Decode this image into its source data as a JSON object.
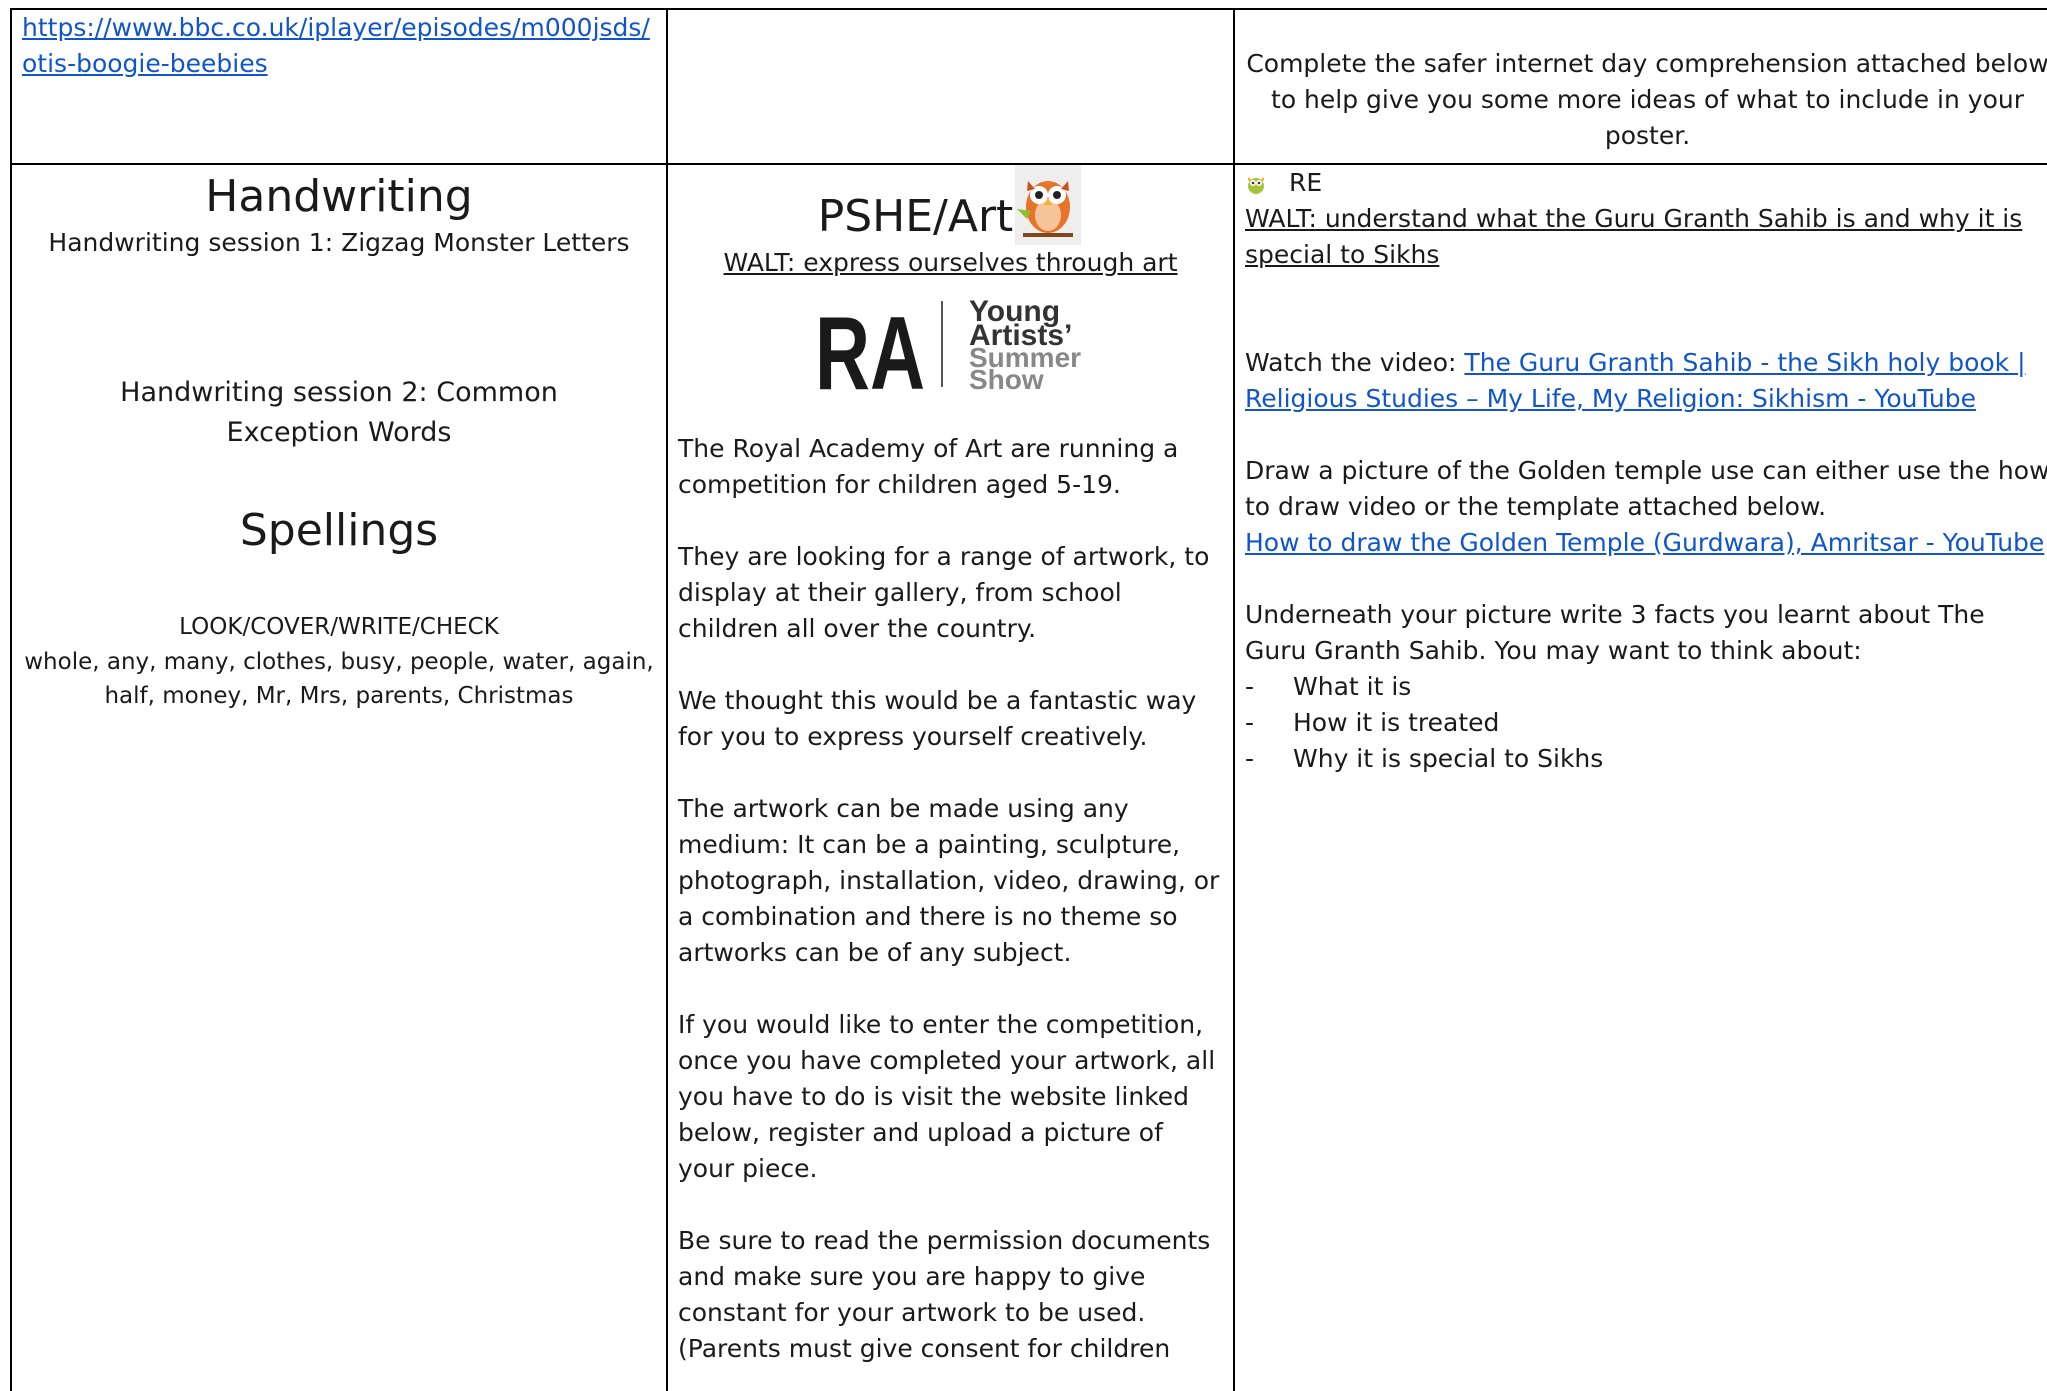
{
  "top_row": {
    "link_text_line1": "https://www.bbc.co.uk/iplayer/episodes/m000jsds/",
    "link_text_line2": "otis-boogie-beebies",
    "comprehension_text": "Complete the safer internet day comprehension attached below to help give you some more ideas of what to include in your poster."
  },
  "handwriting": {
    "heading": "Handwriting",
    "session1": "Handwriting session 1: Zigzag Monster Letters",
    "session2": "Handwriting session 2: Common Exception Words",
    "spellings_heading": "Spellings",
    "method": "LOOK/COVER/WRITE/CHECK",
    "words": "whole, any, many, clothes, busy, people, water, again, half, money, Mr, Mrs, parents, Christmas"
  },
  "pshe_art": {
    "heading": "PSHE/Art",
    "owl_icon": "owl-icon",
    "walt": "WALT: express ourselves through art",
    "logo": {
      "ra": "RA",
      "line1": "Young",
      "line2": "Artists’",
      "line3": "Summer",
      "line4": "Show"
    },
    "paragraphs": [
      "The Royal Academy of Art are running a competition for children aged 5-19.",
      "They are looking for a range of artwork, to display at their gallery, from school children all over the country.",
      "We thought this would be a fantastic way for you to express yourself creatively.",
      "The artwork can be made using any medium: It can be a painting, sculpture, photograph, installation, video, drawing, or a combination and there is no theme so artworks can be of any subject.",
      "If you would like to enter the competition, once you have completed your artwork, all you have to do is visit the website linked below, register and upload a picture of your piece.",
      "Be sure to read the permission documents and make sure you are happy to give constant for your artwork to be used. (Parents must give consent for children"
    ]
  },
  "re": {
    "heading": "RE",
    "owl_icon": "owl-icon",
    "walt": "WALT: understand what the Guru Granth Sahib is and why it is special to Sikhs",
    "watch_prefix": "Watch the video: ",
    "watch_link": "The Guru Granth Sahib - the Sikh holy book | Religious Studies – My Life, My Religion: Sikhism - YouTube",
    "draw_text": "Draw a picture of the Golden temple use can either use the how to draw video or the template attached below.",
    "draw_link": "How to draw the Golden Temple (Gurdwara), Amritsar - YouTube",
    "facts_text": "Underneath your picture write 3 facts you learnt about The Guru Granth Sahib. You may want to think about:",
    "bullets": [
      "What it is",
      "How it is treated",
      "Why it is special to Sikhs"
    ]
  },
  "colors": {
    "link": "#1155cc",
    "border": "#000000",
    "text": "#1a1a1a"
  }
}
